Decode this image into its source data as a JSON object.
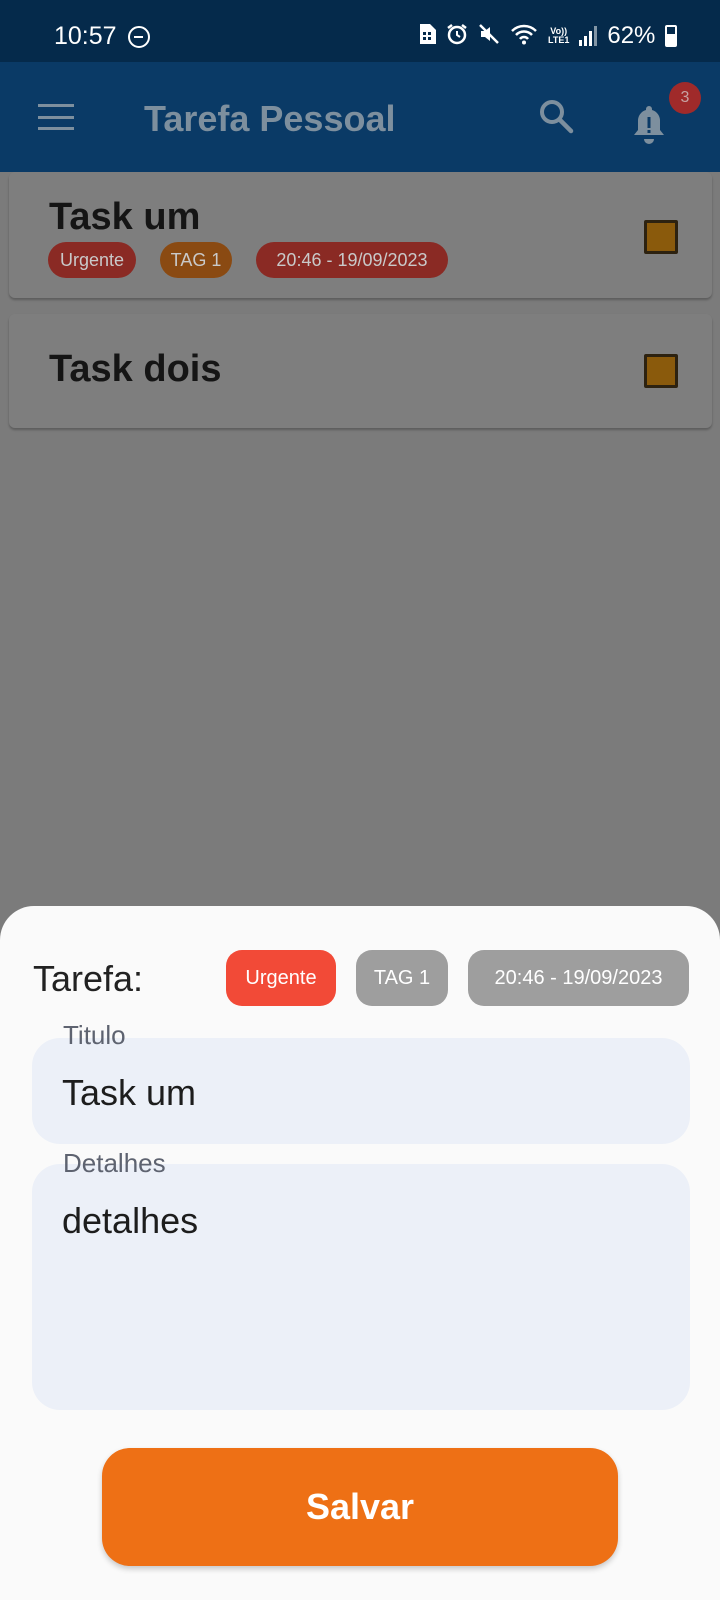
{
  "status_bar": {
    "time": "10:57",
    "battery": "62%",
    "network_label_top": "Vo))",
    "network_label_bottom": "LTE1"
  },
  "app_bar": {
    "title": "Tarefa Pessoal",
    "notification_count": "3"
  },
  "tasks": [
    {
      "title": "Task um",
      "tags": [
        "Urgente",
        "TAG 1",
        "20:46 - 19/09/2023"
      ]
    },
    {
      "title": "Task dois",
      "tags": []
    }
  ],
  "sheet": {
    "label": "Tarefa:",
    "chips": [
      "Urgente",
      "TAG 1",
      "20:46 - 19/09/2023"
    ],
    "titulo_label": "Titulo",
    "titulo_value": "Task um",
    "detalhes_label": "Detalhes",
    "detalhes_value": "detalhes",
    "save_label": "Salvar"
  },
  "colors": {
    "status_bar": "#052a4b",
    "app_bar": "#0a3a66",
    "urgent": "#f24a37",
    "neutral_chip": "#9e9e9e",
    "save_button": "#ee7015",
    "field_background": "#ecf0f8"
  },
  "icons": {
    "status": [
      "do-not-disturb-icon",
      "sim-card-icon",
      "alarm-icon",
      "mute-icon",
      "wifi-icon",
      "signal-icon",
      "battery-icon"
    ],
    "app_bar": [
      "menu-icon",
      "search-icon",
      "bell-icon"
    ]
  }
}
